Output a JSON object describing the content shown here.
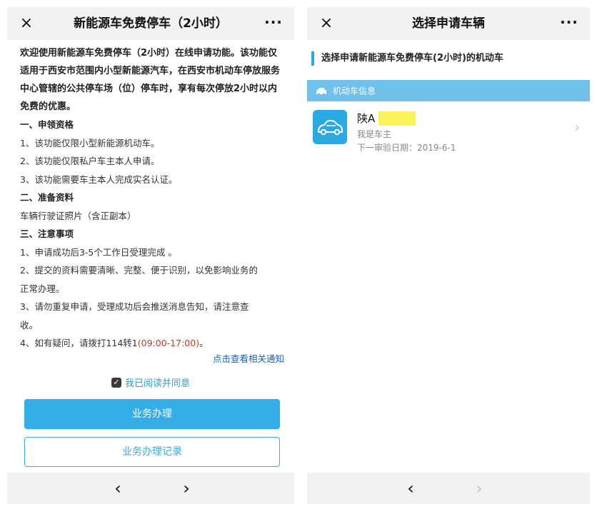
{
  "left_panel": {
    "title": "新能源车免费停车（2小时）",
    "close_icon": "×",
    "more_icon": "···",
    "intro": "欢迎使用新能源车免费停车（2小时）在线申请功能。该功能仅适用于西安市范围内小型新能源汽车，在西安市机动车停放服务中心管辖的公共停车场（位）停车时，享有每次停放2小时以内免费的优惠。",
    "section1_title": "一、申领资格",
    "section1_items": [
      "1、该功能仅限小型新能源机动车。",
      "2、该功能仅限私户车主本人申请。",
      "3、该功能需要车主本人完成实名认证。"
    ],
    "section2_title": "二、准备资料",
    "section2_items": [
      "车辆行驶证照片（含正副本）"
    ],
    "section3_title": "三、注意事项",
    "section3_items": [
      "1、申请成功后3-5个工作日受理完成 。",
      "2、提交的资料需要清晰、完整、便于识别，以免影响业务的",
      "正常办理。",
      "3、请勿重复申请，受理成功后会推送消息告知，请注意查",
      "收。"
    ],
    "section3_last_prefix": "4、如有疑问，请拨打114转1",
    "section3_last_hours": "(09:00-17:00)",
    "section3_last_suffix": "。",
    "notice_link": "点击查看相关通知",
    "agree_label": "我已阅读并同意",
    "agree_checked": true,
    "primary_button": "业务办理",
    "secondary_button": "业务办理记录",
    "nav_back": "‹",
    "nav_forward": "›"
  },
  "right_panel": {
    "title": "选择申请车辆",
    "close_icon": "×",
    "more_icon": "···",
    "section_title": "选择申请新能源车免费停车(2小时)的机动车",
    "info_bar_label": "机动车信息",
    "vehicle": {
      "plate_prefix": "陕A",
      "owner_label": "我是车主",
      "inspection_label": "下一审验日期：2019-6-1"
    },
    "nav_back": "‹",
    "nav_forward": "›"
  },
  "colors": {
    "accent": "#35aee8",
    "info_bar": "#6fc0eb",
    "phone_hours": "#c0392b",
    "link": "#1a5fb4",
    "plate_mask": "#fdf25a"
  },
  "icons": {
    "close": "close-icon",
    "more": "more-icon",
    "checkbox": "checkbox-checked-icon",
    "car": "car-icon",
    "chevron": "chevron-right-icon"
  }
}
